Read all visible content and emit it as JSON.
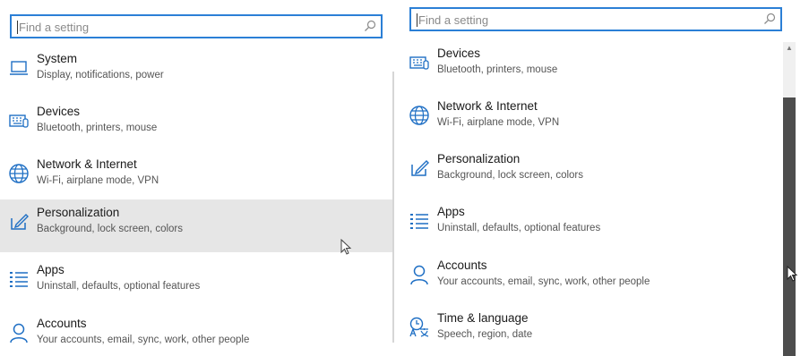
{
  "left": {
    "search": {
      "placeholder": "Find a setting"
    },
    "items": [
      {
        "title": "System",
        "subtitle": "Display, notifications, power",
        "icon": "laptop-icon"
      },
      {
        "title": "Devices",
        "subtitle": "Bluetooth, printers, mouse",
        "icon": "keyboard-icon"
      },
      {
        "title": "Network & Internet",
        "subtitle": "Wi-Fi, airplane mode, VPN",
        "icon": "globe-icon"
      },
      {
        "title": "Personalization",
        "subtitle": "Background, lock screen, colors",
        "icon": "pen-tablet-icon",
        "selected": true
      },
      {
        "title": "Apps",
        "subtitle": "Uninstall, defaults, optional features",
        "icon": "list-icon"
      },
      {
        "title": "Accounts",
        "subtitle": "Your accounts, email, sync, work, other people",
        "icon": "person-icon"
      }
    ]
  },
  "right": {
    "search": {
      "placeholder": "Find a setting"
    },
    "items": [
      {
        "title": "Devices",
        "subtitle": "Bluetooth, printers, mouse",
        "icon": "keyboard-icon"
      },
      {
        "title": "Network & Internet",
        "subtitle": "Wi-Fi, airplane mode, VPN",
        "icon": "globe-icon"
      },
      {
        "title": "Personalization",
        "subtitle": "Background, lock screen, colors",
        "icon": "pen-tablet-icon"
      },
      {
        "title": "Apps",
        "subtitle": "Uninstall, defaults, optional features",
        "icon": "list-icon"
      },
      {
        "title": "Accounts",
        "subtitle": "Your accounts, email, sync, work, other people",
        "icon": "person-icon"
      },
      {
        "title": "Time & language",
        "subtitle": "Speech, region, date",
        "icon": "time-language-icon"
      }
    ]
  },
  "colors": {
    "accent": "#2b7fd6",
    "icon": "#1f6fc4",
    "selected_bg": "#e6e6e6",
    "scroll_thumb": "#4d4d4d"
  }
}
